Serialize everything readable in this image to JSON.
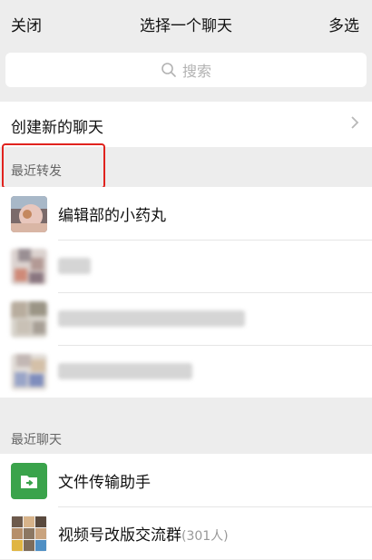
{
  "topbar": {
    "close_label": "关闭",
    "title": "选择一个聊天",
    "multi_label": "多选"
  },
  "search": {
    "placeholder": "搜索"
  },
  "create_chat": {
    "label": "创建新的聊天"
  },
  "recent_forward": {
    "title": "最近转发",
    "items": [
      {
        "name": "编辑部的小药丸"
      },
      {
        "name": ""
      },
      {
        "name": ""
      },
      {
        "name": ""
      }
    ]
  },
  "recent_chats": {
    "title": "最近聊天",
    "items": [
      {
        "name": "文件传输助手",
        "count": ""
      },
      {
        "name": "视频号改版交流群",
        "count": "(301人)"
      }
    ]
  },
  "colors": {
    "highlight": "#e0231e",
    "file_helper_green": "#3aa34b"
  }
}
